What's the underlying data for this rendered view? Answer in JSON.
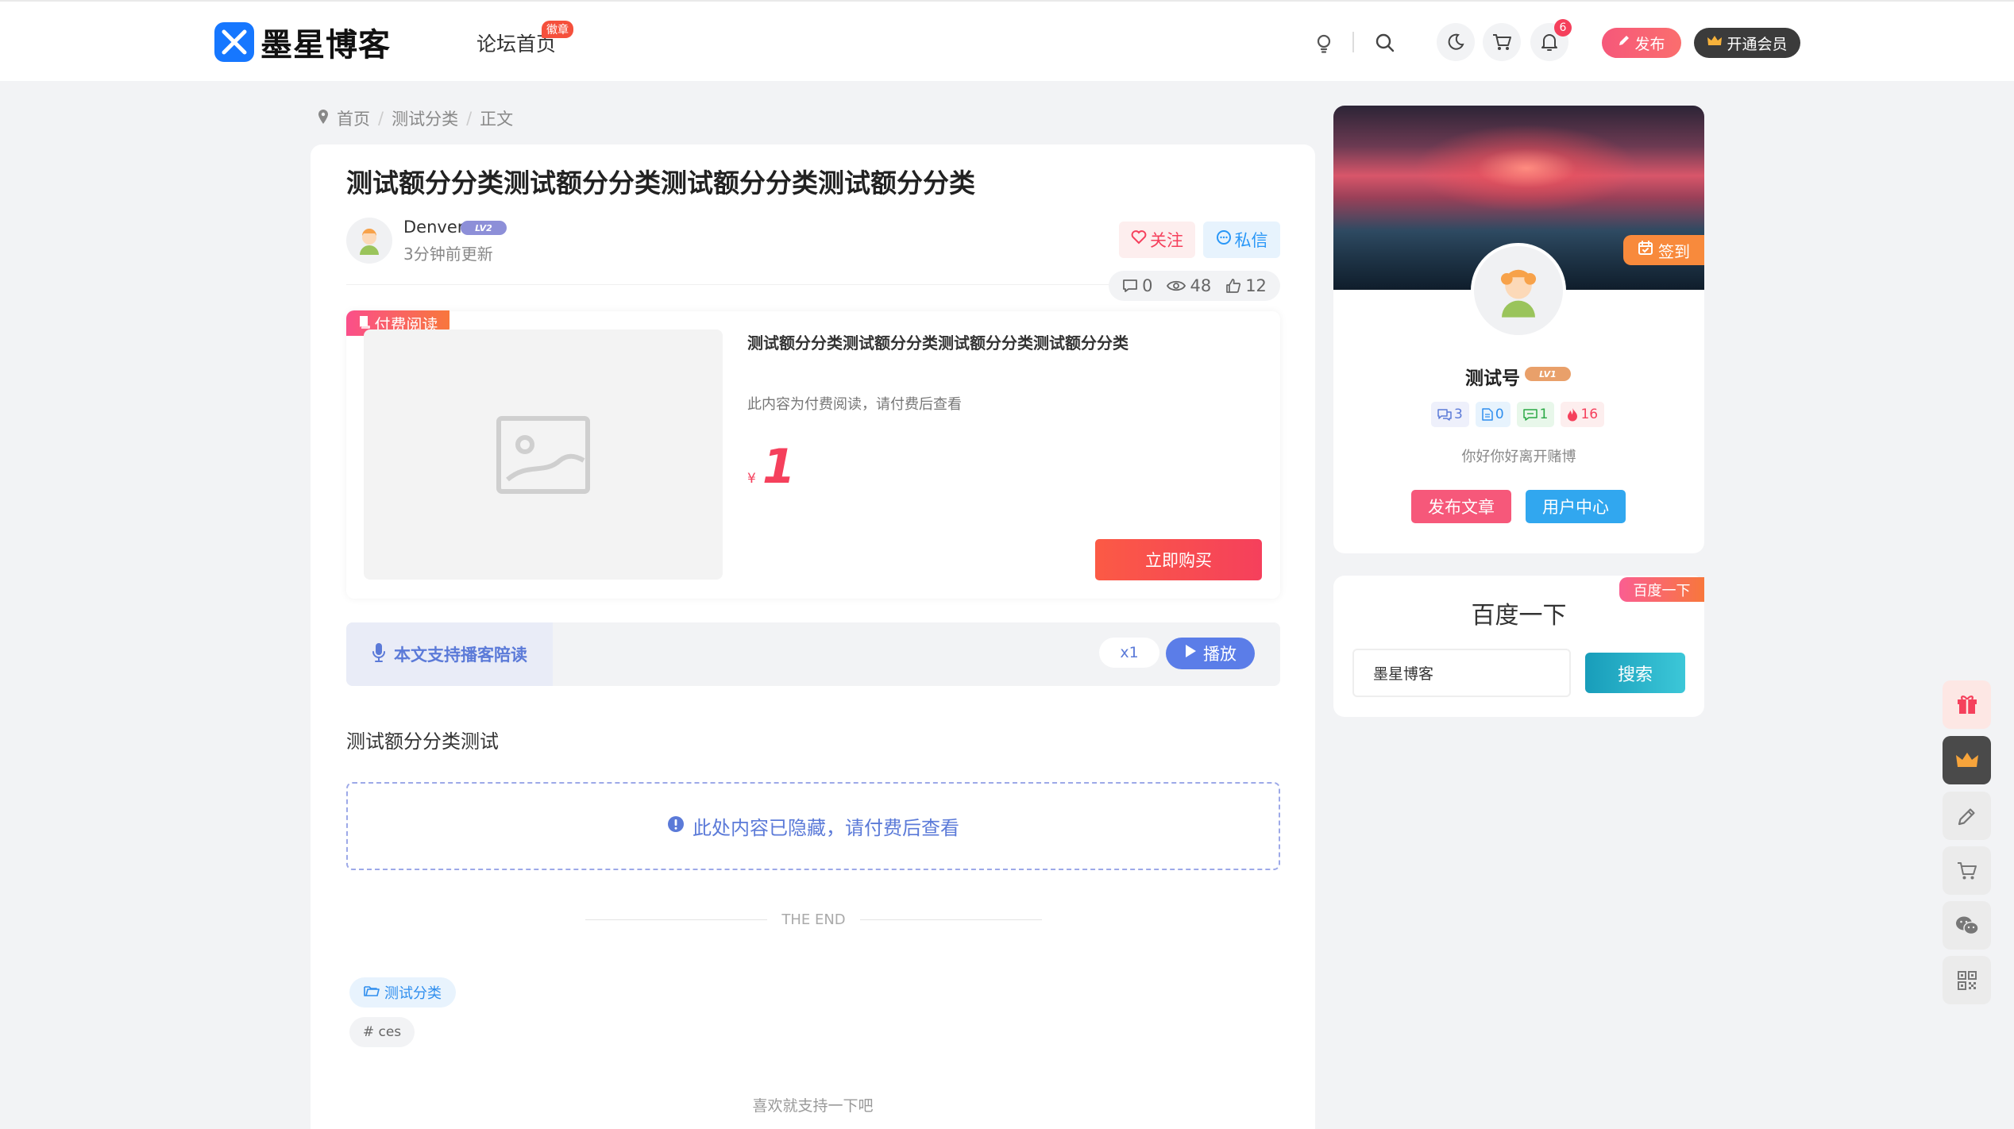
{
  "header": {
    "logo_text": "墨星博客",
    "nav_forum": "论坛首页",
    "nav_badge": "徽章",
    "notification_count": "6",
    "publish_label": "发布",
    "vip_label": "开通会员"
  },
  "breadcrumb": [
    "首页",
    "测试分类",
    "正文"
  ],
  "post": {
    "title": "测试额分分类测试额分分类测试额分分类测试额分分类",
    "author": "Denver",
    "author_level": "LV2",
    "updated": "3分钟前更新",
    "follow_label": "关注",
    "message_label": "私信",
    "comments": "0",
    "views": "48",
    "likes": "12",
    "pay": {
      "tag": "付费阅读",
      "title": "测试额分分类测试额分分类测试额分分类测试额分分类",
      "desc": "此内容为付费阅读，请付费后查看",
      "currency": "¥",
      "price": "1",
      "buy_label": "立即购买"
    },
    "audio": {
      "label": "本文支持播客陪读",
      "speed": "x1",
      "play_label": "播放"
    },
    "body_text": "测试额分分类测试",
    "hidden_notice": "此处内容已隐藏，请付费后查看",
    "the_end": "THE END",
    "category": "测试分类",
    "keyword": "# ces",
    "support_text": "喜欢就支持一下吧"
  },
  "profile": {
    "checkin_label": "签到",
    "name": "测试号",
    "level": "LV1",
    "stats": {
      "a": "3",
      "b": "0",
      "c": "1",
      "d": "16"
    },
    "bio": "你好你好离开赌博",
    "post_button": "发布文章",
    "ucenter_button": "用户中心"
  },
  "search": {
    "ribbon": "百度一下",
    "title": "百度一下",
    "value": "墨星博客",
    "button": "搜索"
  },
  "colors": {
    "accent_pink": "#f5405c",
    "accent_blue": "#1677ff",
    "audio_blue": "#5b7ad8"
  }
}
